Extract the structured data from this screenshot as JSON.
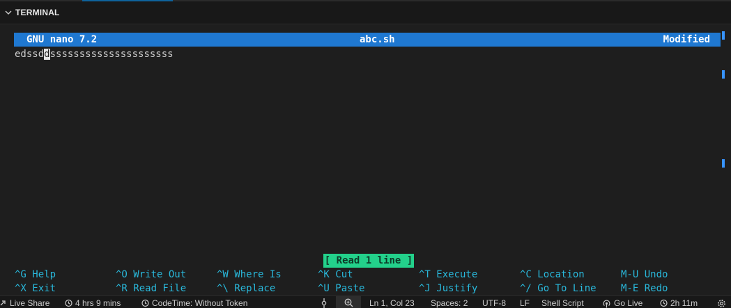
{
  "panel": {
    "title": "TERMINAL"
  },
  "nano": {
    "version": "GNU nano 7.2",
    "filename": "abc.sh",
    "status": "Modified",
    "line_before_cursor": "edssd",
    "cursor_char": "d",
    "line_after_cursor": "sssssssssssssssssssss",
    "message": "[ Read 1 line ]"
  },
  "shortcuts": [
    {
      "label": "^G Help"
    },
    {
      "label": "^O Write Out"
    },
    {
      "label": "^W Where Is"
    },
    {
      "label": "^K Cut"
    },
    {
      "label": "^T Execute"
    },
    {
      "label": "^C Location"
    },
    {
      "label": "M-U Undo"
    },
    {
      "label": "^X Exit"
    },
    {
      "label": "^R Read File"
    },
    {
      "label": "^\\ Replace"
    },
    {
      "label": "^U Paste"
    },
    {
      "label": "^J Justify"
    },
    {
      "label": "^/ Go To Line"
    },
    {
      "label": "M-E Redo"
    }
  ],
  "statusbar": {
    "live_share": "Live Share",
    "hours": "4 hrs 9 mins",
    "codetime": "CodeTime: Without Token",
    "position": "Ln 1, Col 23",
    "spaces": "Spaces: 2",
    "encoding": "UTF-8",
    "eol": "LF",
    "language": "Shell Script",
    "go_live": "Go Live",
    "time": "2h 11m"
  },
  "colors": {
    "nano_bar": "#1f78d1",
    "shortcut_text": "#29b8db",
    "message_bg": "#23d18b",
    "terminal_bg": "#1e1e1e"
  }
}
